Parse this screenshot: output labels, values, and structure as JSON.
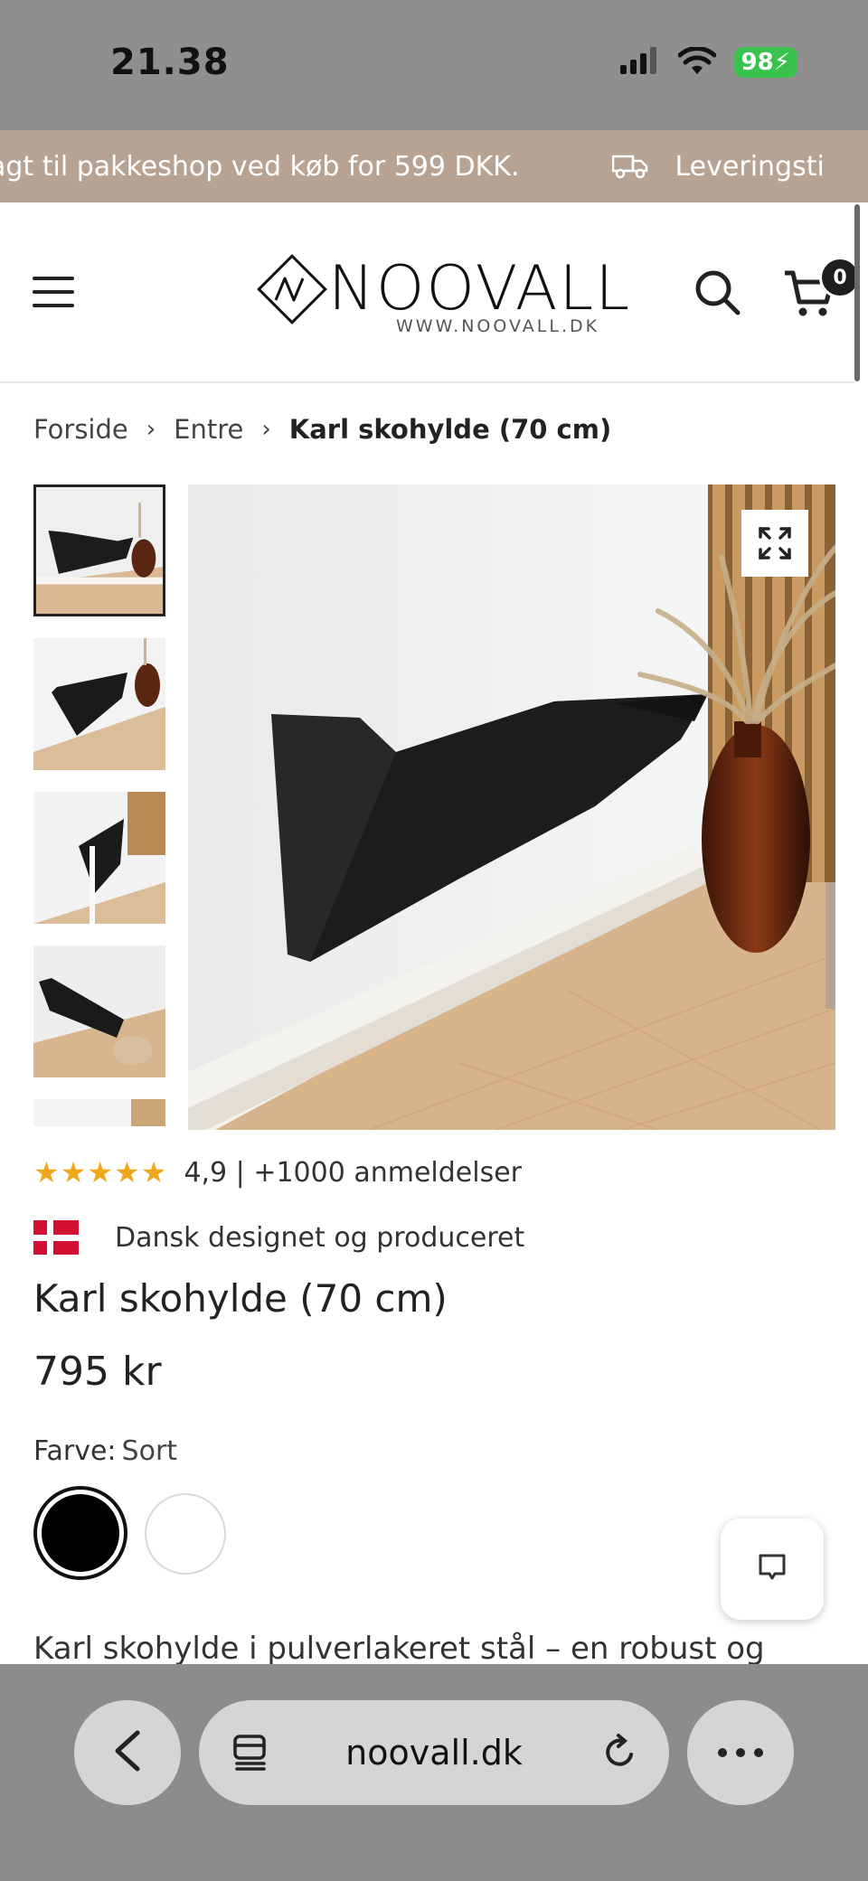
{
  "status_bar": {
    "time": "21.38",
    "battery": "98"
  },
  "announcement": {
    "text": "agt til pakkeshop ved køb for 599 DKK.",
    "text2": "Leveringsti"
  },
  "header": {
    "logo_text": "NOOVALL",
    "logo_url": "WWW.NOOVALL.DK",
    "cart_count": "0"
  },
  "breadcrumb": {
    "home": "Forside",
    "category": "Entre",
    "current": "Karl skohylde (70 cm)",
    "separator": "›"
  },
  "rating": {
    "stars": "★★★★★",
    "text": "4,9 | +1000 anmeldelser"
  },
  "badge": {
    "text": "Dansk designet og produceret"
  },
  "product": {
    "title": "Karl skohylde (70 cm)",
    "price": "795 kr",
    "color_label": "Farve:",
    "color_value": "Sort",
    "colors": [
      "#000000",
      "#ffffff"
    ],
    "description": "Karl skohylde i pulverlakeret stål – en robust og"
  },
  "browser": {
    "url": "noovall.dk"
  },
  "icons": [
    "signal-icon",
    "wifi-icon",
    "truck-icon",
    "menu-icon",
    "search-icon",
    "cart-icon",
    "expand-icon",
    "chat-icon",
    "back-icon",
    "tabs-icon",
    "reload-icon",
    "more-icon"
  ]
}
